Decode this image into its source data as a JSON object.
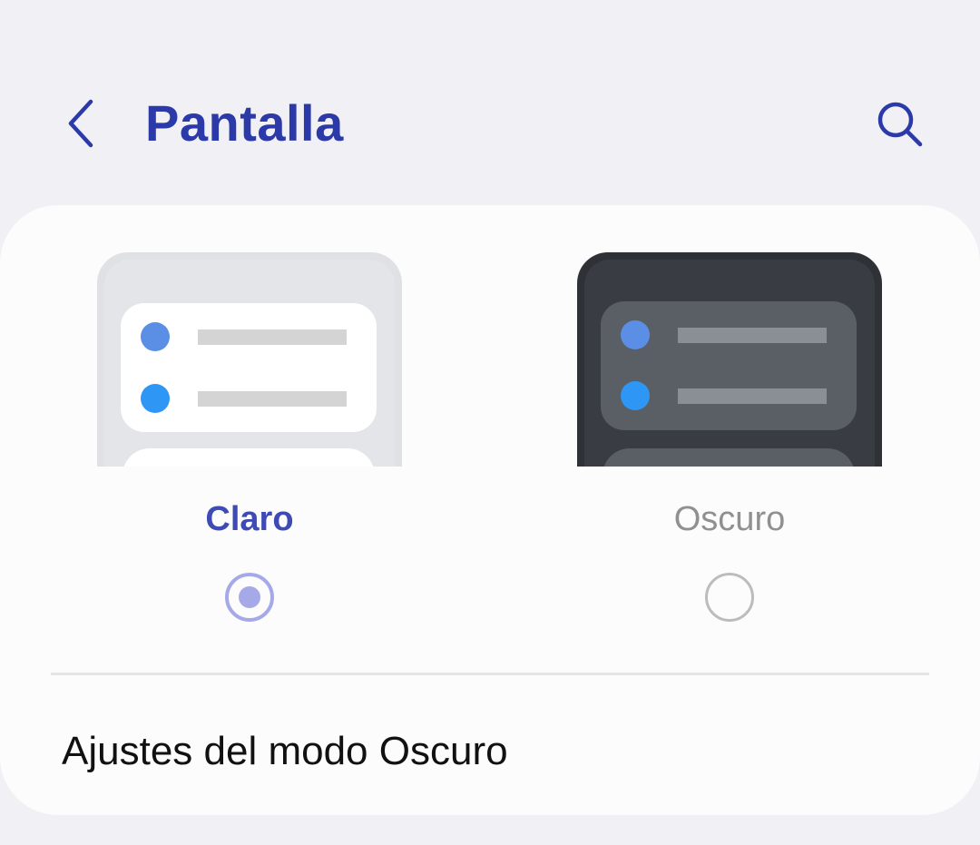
{
  "header": {
    "title": "Pantalla",
    "back_icon": "chevron-left-icon",
    "search_icon": "search-icon",
    "accent_color": "#2b3aa8"
  },
  "theme_selector": {
    "options": [
      {
        "label": "Claro",
        "selected": true,
        "preview": "light"
      },
      {
        "label": "Oscuro",
        "selected": false,
        "preview": "dark"
      }
    ],
    "selected_color": "#3e4bb4",
    "unselected_color": "#909090",
    "radio_selected_color": "#a6a9e8"
  },
  "settings": {
    "dark_mode_settings_label": "Ajustes del modo Oscuro"
  }
}
